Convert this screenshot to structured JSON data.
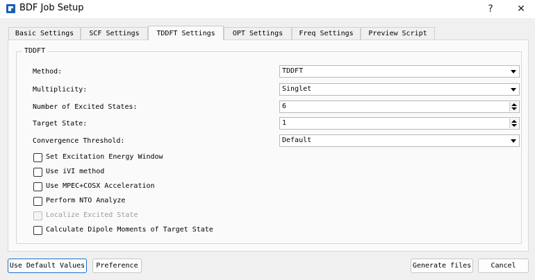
{
  "window": {
    "title": "BDF Job Setup",
    "help_label": "?",
    "close_label": "✕"
  },
  "tabs": [
    {
      "label": "Basic Settings",
      "active": false
    },
    {
      "label": "SCF Settings",
      "active": false
    },
    {
      "label": "TDDFT Settings",
      "active": true
    },
    {
      "label": "OPT Settings",
      "active": false
    },
    {
      "label": "Freq Settings",
      "active": false
    },
    {
      "label": "Preview Script",
      "active": false
    }
  ],
  "tddft": {
    "group_title": "TDDFT",
    "method": {
      "label": "Method:",
      "value": "TDDFT"
    },
    "multiplicity": {
      "label": "Multiplicity:",
      "value": "Singlet"
    },
    "num_states": {
      "label": "Number of Excited States:",
      "value": "6"
    },
    "target_state": {
      "label": "Target State:",
      "value": "1"
    },
    "convergence": {
      "label": "Convergence Threshold:",
      "value": "Default"
    },
    "checkboxes": [
      {
        "label": "Set Excitation Energy Window",
        "checked": false,
        "enabled": true
      },
      {
        "label": "Use iVI method",
        "checked": false,
        "enabled": true
      },
      {
        "label": "Use MPEC+COSX Acceleration",
        "checked": false,
        "enabled": true
      },
      {
        "label": "Perform NTO Analyze",
        "checked": false,
        "enabled": true
      },
      {
        "label": "Localize Excited State",
        "checked": false,
        "enabled": false
      },
      {
        "label": "Calculate Dipole Moments of Target State",
        "checked": false,
        "enabled": true
      }
    ]
  },
  "footer": {
    "default_values_label": "Use Default Values",
    "preference_label": "Preference",
    "generate_label": "Generate files",
    "cancel_label": "Cancel"
  }
}
